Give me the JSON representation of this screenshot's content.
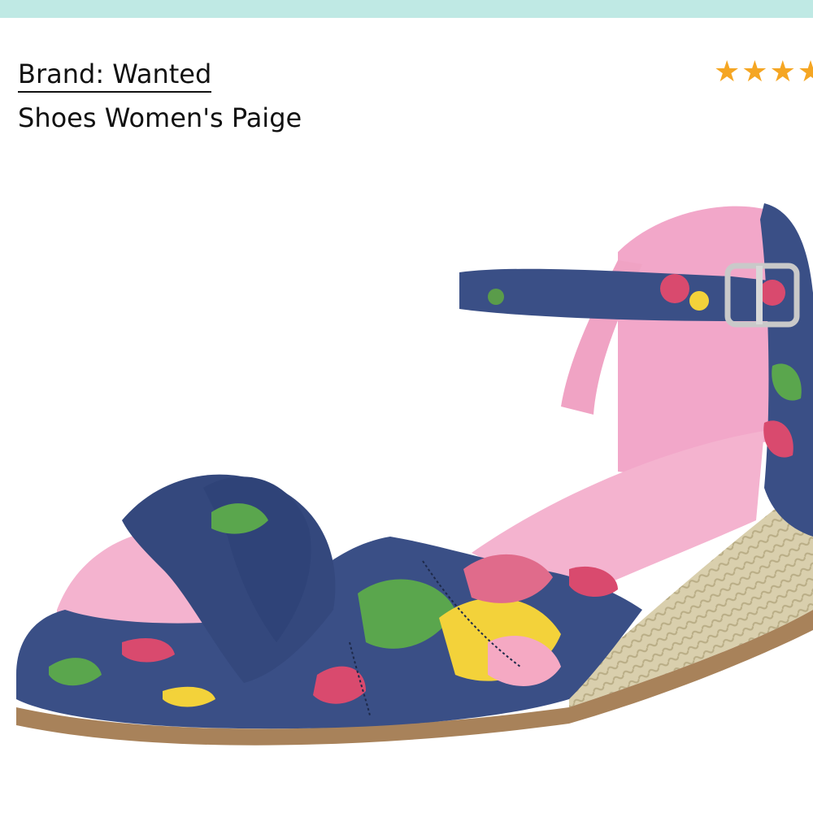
{
  "header": {
    "brand_link": "Brand: Wanted",
    "product_title": "Shoes Women's Paige"
  },
  "rating": {
    "icon": "star-icon",
    "shown_stars": 4,
    "star_color": "#f5a623"
  },
  "colors": {
    "top_bar": "#bfe9e4",
    "denim": "#3a4f86",
    "lining_pink": "#f2a7c9",
    "jute": "#d9cfad"
  }
}
